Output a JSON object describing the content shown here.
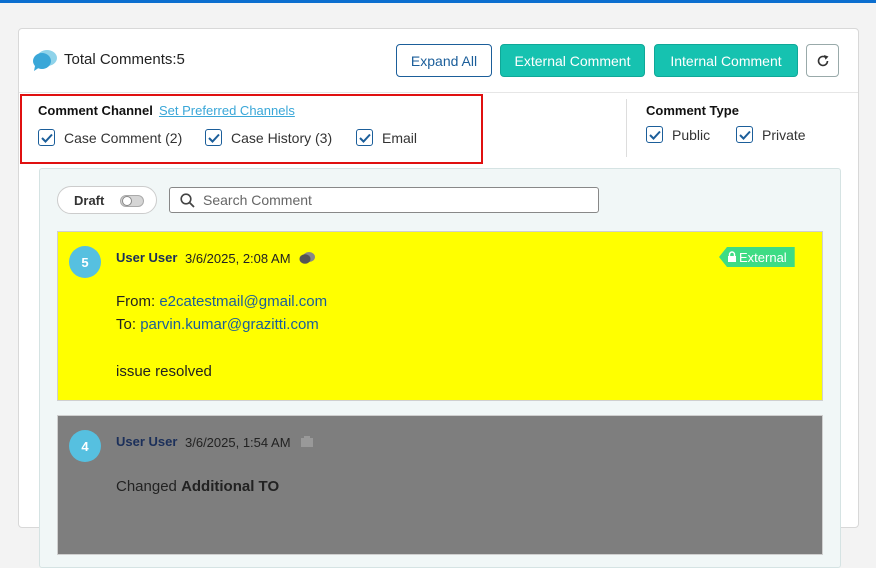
{
  "header": {
    "total_label": "Total Comments:",
    "total_count": "5",
    "expand_all": "Expand All",
    "external_comment": "External Comment",
    "internal_comment": "Internal Comment"
  },
  "filters": {
    "channel_title": "Comment Channel",
    "preferred_link": "Set Preferred Channels",
    "channels": [
      {
        "label": "Case Comment (2)",
        "checked": true
      },
      {
        "label": "Case History (3)",
        "checked": true
      },
      {
        "label": "Email",
        "checked": true
      }
    ],
    "type_title": "Comment Type",
    "types": [
      {
        "label": "Public",
        "checked": true
      },
      {
        "label": "Private",
        "checked": true
      }
    ]
  },
  "toolbar": {
    "draft_label": "Draft",
    "draft_on": false,
    "search_placeholder": "Search Comment"
  },
  "comments": [
    {
      "number": "5",
      "author": "User User",
      "date": "3/6/2025, 2:08 AM",
      "tag": "External",
      "from_label": "From:",
      "from_email": "e2catestmail@gmail.com",
      "to_label": "To:",
      "to_email": "parvin.kumar@grazitti.com",
      "text": "issue resolved",
      "background": "#ffff00"
    },
    {
      "number": "4",
      "author": "User User",
      "date": "3/6/2025, 1:54 AM",
      "text_prefix": "Changed ",
      "text_bold": "Additional TO",
      "background": "#7e7e7e"
    }
  ],
  "colors": {
    "accent_teal": "#16c2b0",
    "primary_blue": "#1b5e9a",
    "highlight_red": "#e01010",
    "external_green": "#3ddc84"
  }
}
